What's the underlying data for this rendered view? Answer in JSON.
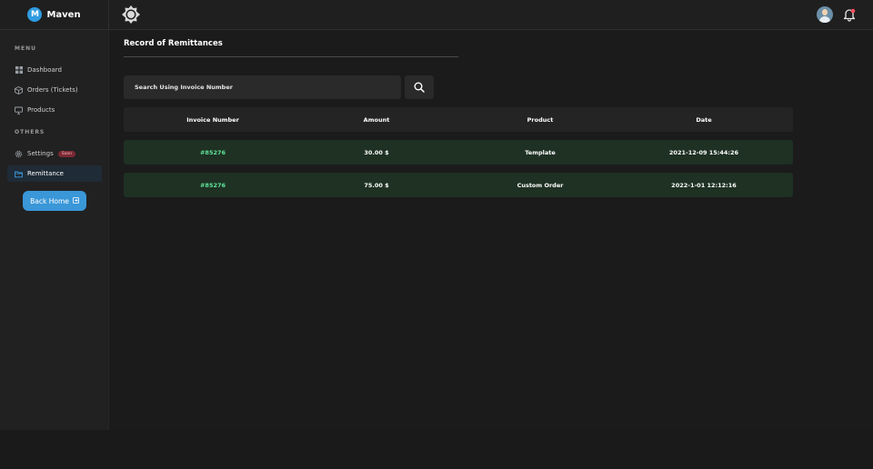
{
  "brand": {
    "logo_letter": "M",
    "name": "Maven"
  },
  "sidebar": {
    "menu_label": "MENU",
    "others_label": "OTHERS",
    "items": [
      {
        "label": "Dashboard",
        "icon": "dashboard-icon"
      },
      {
        "label": "Orders (Tickets)",
        "icon": "box-icon"
      },
      {
        "label": "Products",
        "icon": "monitor-icon"
      }
    ],
    "others": [
      {
        "label": "Settings",
        "icon": "gear-icon",
        "badge": "Soon"
      },
      {
        "label": "Remittance",
        "icon": "folder-icon",
        "active": true
      }
    ],
    "back_home": {
      "label": "Back Home",
      "icon": "exit-icon"
    }
  },
  "page": {
    "title": "Record of Remittances"
  },
  "search": {
    "placeholder": "Search Using Invoice Number",
    "button_icon": "search-icon"
  },
  "table": {
    "columns": [
      "Invoice Number",
      "Amount",
      "Product",
      "Date"
    ],
    "rows": [
      {
        "invoice": "#85276",
        "amount": "30.00 $",
        "product": "Template",
        "date": "2021-12-09 15:44:26"
      },
      {
        "invoice": "#85276",
        "amount": "75.00 $",
        "product": "Custom Order",
        "date": "2022-1-01 12:12:16"
      }
    ]
  },
  "colors": {
    "accent": "#3a97d8",
    "row_bg": "#1e3123",
    "invoice_text": "#5fe39a",
    "badge_bg": "#7a2a34"
  }
}
